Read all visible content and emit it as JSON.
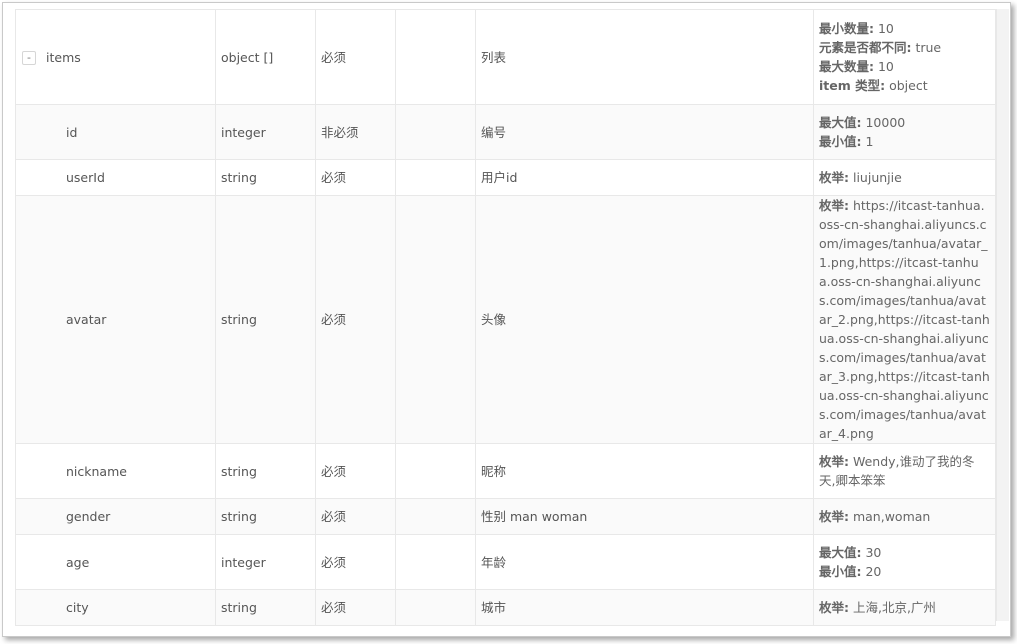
{
  "rows": [
    {
      "name": "items",
      "type": "object []",
      "required": "必须",
      "default": "",
      "remark": "列表",
      "toggle": "-",
      "other": [
        {
          "key": "最小数量:",
          "value": " 10"
        },
        {
          "key": "元素是否都不同:",
          "value": " true"
        },
        {
          "key": "最大数量:",
          "value": " 10"
        },
        {
          "key": "item 类型:",
          "value": " object"
        }
      ]
    },
    {
      "name": "id",
      "type": "integer",
      "required": "非必须",
      "default": "",
      "remark": "编号",
      "other": [
        {
          "key": "最大值:",
          "value": " 10000"
        },
        {
          "key": "最小值:",
          "value": " 1"
        }
      ]
    },
    {
      "name": "userId",
      "type": "string",
      "required": "必须",
      "default": "",
      "remark": "用户id",
      "other": [
        {
          "key": "枚举:",
          "value": " liujunjie"
        }
      ]
    },
    {
      "name": "avatar",
      "type": "string",
      "required": "必须",
      "default": "",
      "remark": "头像",
      "other": [
        {
          "key": "枚举:",
          "value": " https://itcast-tanhua.oss-cn-shanghai.aliyuncs.com/images/tanhua/avatar_1.png,https://itcast-tanhua.oss-cn-shanghai.aliyuncs.com/images/tanhua/avatar_2.png,https://itcast-tanhua.oss-cn-shanghai.aliyuncs.com/images/tanhua/avatar_3.png,https://itcast-tanhua.oss-cn-shanghai.aliyuncs.com/images/tanhua/avatar_4.png"
        }
      ]
    },
    {
      "name": "nickname",
      "type": "string",
      "required": "必须",
      "default": "",
      "remark": "昵称",
      "other": [
        {
          "key": "枚举:",
          "value": " Wendy,谁动了我的冬天,卿本笨笨"
        }
      ]
    },
    {
      "name": "gender",
      "type": "string",
      "required": "必须",
      "default": "",
      "remark": "性别 man woman",
      "other": [
        {
          "key": "枚举:",
          "value": " man,woman"
        }
      ]
    },
    {
      "name": "age",
      "type": "integer",
      "required": "必须",
      "default": "",
      "remark": "年龄",
      "other": [
        {
          "key": "最大值:",
          "value": " 30"
        },
        {
          "key": "最小值:",
          "value": " 20"
        }
      ]
    },
    {
      "name": "city",
      "type": "string",
      "required": "必须",
      "default": "",
      "remark": "城市",
      "other": [
        {
          "key": "枚举:",
          "value": " 上海,北京,广州"
        }
      ]
    }
  ]
}
